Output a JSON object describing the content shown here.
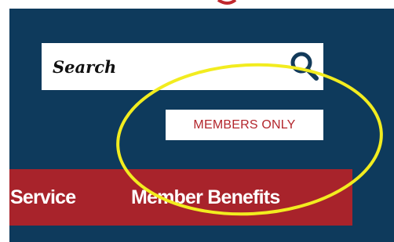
{
  "search": {
    "placeholder": "Search",
    "icon": "search-icon"
  },
  "members_only": {
    "label": "MEMBERS ONLY"
  },
  "nav": {
    "items": [
      {
        "label": "Service"
      },
      {
        "label": "Member Benefits"
      }
    ]
  },
  "colors": {
    "panel_background": "#0e3a5c",
    "nav_background": "#a8232b",
    "members_text": "#b3262c",
    "highlight_ellipse": "#f2ec1f",
    "search_icon": "#123a5a"
  }
}
